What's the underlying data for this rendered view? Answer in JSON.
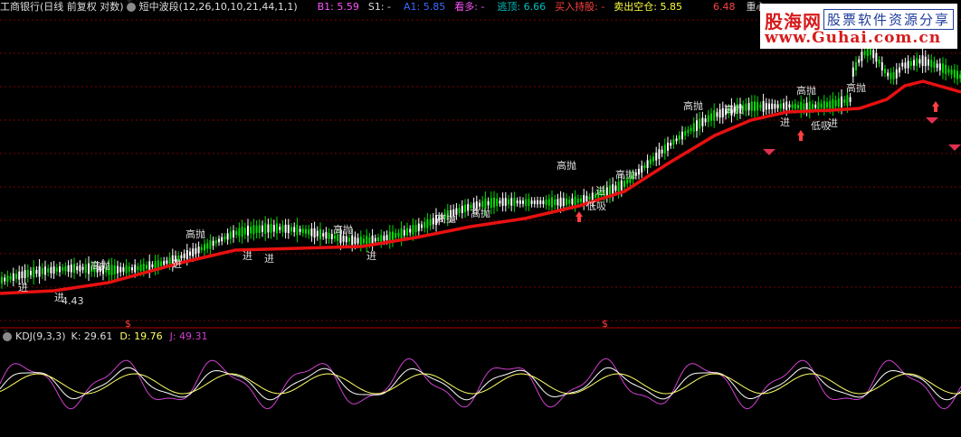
{
  "main_header": {
    "stock": "工商银行(日线 前复权 对数)",
    "indicator": "短中波段(12,26,10,10,21,44,1,1)",
    "b1_label": "B1: 5.59",
    "s1_label": "S1: -",
    "a1_label": "A1: 5.85",
    "bull_label": "看多: -",
    "escape_label": "逃顶: 6.66",
    "buy_hold_label": "买入持股: -",
    "sell_short_label": "卖出空仓: 5.85",
    "price_label": "6.48",
    "center_label": "重心:"
  },
  "sub_header": {
    "indicator": "KDJ(9,3,3)",
    "k_label": "K: 29.61",
    "d_label": "D: 19.76",
    "j_label": "J: 49.31"
  },
  "logo": {
    "cn_name": "股海网",
    "slogan": "股票软件资源分享",
    "url": "www.Guhai.com.cn"
  },
  "annotations": {
    "high_sell": "高抛",
    "enter": "进",
    "low_buy": "低吸",
    "low_value": "4.43",
    "dollar": "$"
  },
  "colors": {
    "background": "#000000",
    "grid": "#7a0000",
    "trend_line": "#e81010",
    "candle_up": "#00dd00",
    "candle_down": "#ffffff",
    "k_line": "#ffffff",
    "d_line": "#ffff66",
    "j_line": "#d040d0",
    "text_white": "#dddddd",
    "text_magenta": "#ff55ff",
    "text_cyan": "#00c0c0",
    "text_red": "#ff4040",
    "text_yellow": "#ffff40",
    "text_blue": "#3a6aff"
  }
}
